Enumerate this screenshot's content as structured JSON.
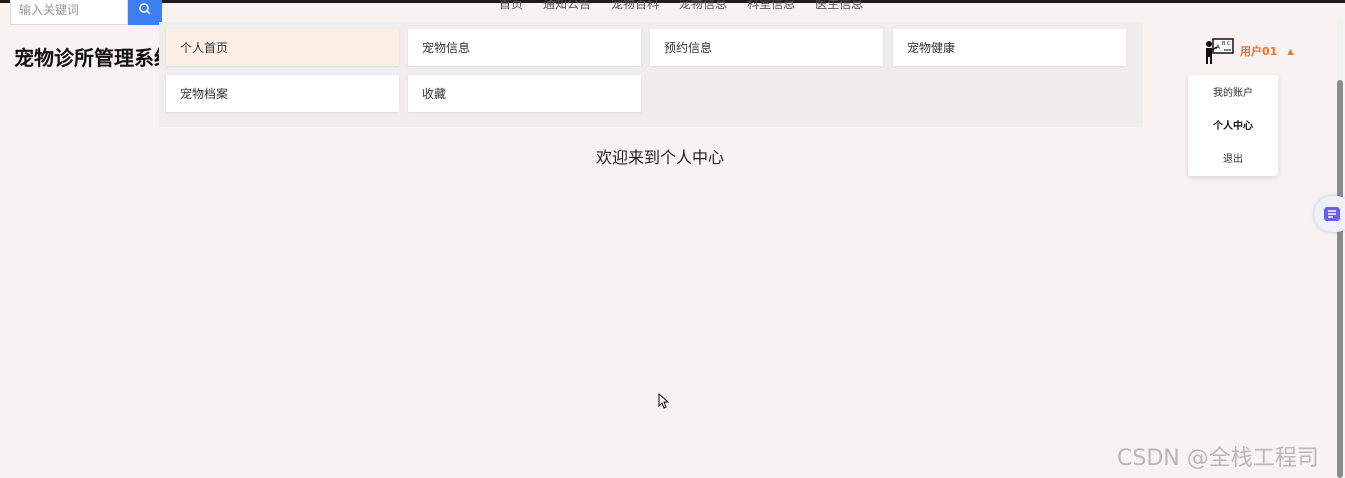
{
  "search": {
    "placeholder": "输入关键词"
  },
  "nav": {
    "items": [
      "首页",
      "通知公告",
      "宠物百科",
      "宠物信息",
      "科室信息",
      "医生信息"
    ]
  },
  "app": {
    "title": "宠物诊所管理系统"
  },
  "menu": {
    "items": [
      {
        "label": "个人首页",
        "active": true
      },
      {
        "label": "宠物信息"
      },
      {
        "label": "预约信息"
      },
      {
        "label": "宠物健康"
      },
      {
        "label": "宠物档案"
      },
      {
        "label": "收藏"
      }
    ]
  },
  "main": {
    "welcome": "欢迎来到个人中心"
  },
  "user": {
    "name": "用户01",
    "dropdown": [
      "我的账户",
      "个人中心",
      "退出"
    ]
  },
  "watermark": "CSDN @全栈工程司",
  "colors": {
    "accent": "#e8742a",
    "search_button": "#3d7ef5",
    "active_menu": "#fbeee4"
  }
}
